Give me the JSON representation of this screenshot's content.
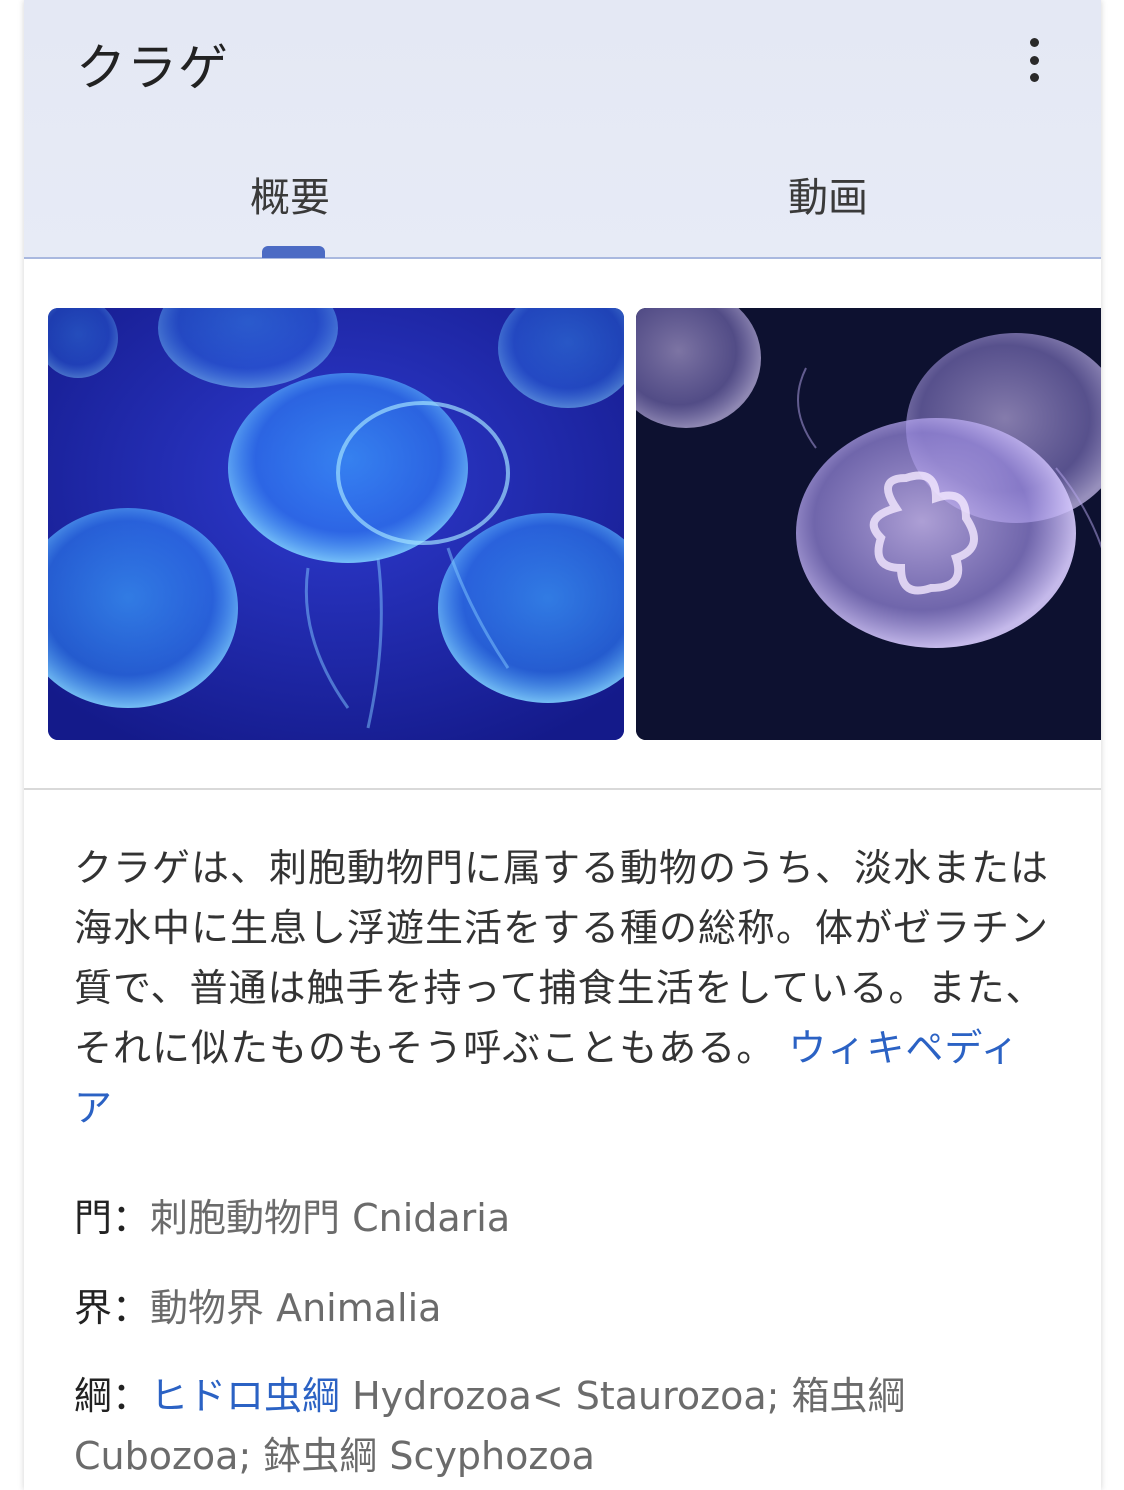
{
  "header": {
    "title": "クラゲ",
    "more_icon": "more-vert-icon",
    "tabs": [
      {
        "label": "概要",
        "selected": true
      },
      {
        "label": "動画",
        "selected": false
      }
    ],
    "accent_color": "#4c6bc4"
  },
  "images": [
    {
      "icon": "jellyfish-photo-blue"
    },
    {
      "icon": "moon-jellyfish-photo"
    }
  ],
  "description": {
    "text": "クラゲは、刺胞動物門に属する動物のうち、淡水または海水中に生息し浮遊生活をする種の総称。体がゼラチン質で、普通は触手を持って捕食生活をしている。また、それに似たものもそう呼ぶこともある。",
    "source_link": "ウィキペディア"
  },
  "facts": [
    {
      "label": "門：",
      "value": "刺胞動物門 Cnidaria"
    },
    {
      "label": "界：",
      "value": "動物界 Animalia"
    },
    {
      "label": "綱：",
      "link": "ヒドロ虫綱",
      "value": " Hydrozoa< Staurozoa; 箱虫綱 Cubozoa; 鉢虫綱 Scyphozoa"
    }
  ]
}
